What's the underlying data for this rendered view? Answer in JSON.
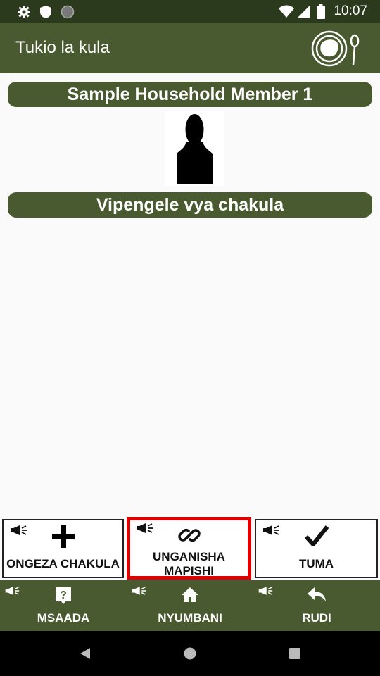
{
  "status_bar": {
    "time": "10:07",
    "left_icons": [
      "gear-icon",
      "shield-icon",
      "circle-icon"
    ],
    "right_icons": [
      "wifi-icon",
      "signal-icon",
      "battery-icon"
    ]
  },
  "app_bar": {
    "title": "Tukio la kula",
    "logo": "plate-spoon-icon"
  },
  "member": {
    "name": "Sample Household Member 1",
    "avatar": "person-silhouette-icon"
  },
  "section": {
    "title": "Vipengele vya chakula"
  },
  "actions": [
    {
      "label": "ONGEZA CHAKULA",
      "icon": "plus-icon",
      "audio_icon": "megaphone-icon"
    },
    {
      "label_line1": "UNGANISHA",
      "label_line2": "MAPISHI",
      "icon": "link-icon",
      "audio_icon": "megaphone-icon",
      "highlighted": true,
      "highlight_color": "#e00000"
    },
    {
      "label": "TUMA",
      "icon": "checkmark-icon",
      "audio_icon": "megaphone-icon"
    }
  ],
  "bottom_nav": [
    {
      "label": "MSAADA",
      "icon": "help-icon"
    },
    {
      "label": "NYUMBANI",
      "icon": "home-icon"
    },
    {
      "label": "RUDI",
      "icon": "back-arrow-icon"
    }
  ],
  "colors": {
    "primary": "#4a5a30",
    "status_bar": "#2b3a1c",
    "highlight": "#e00000"
  }
}
